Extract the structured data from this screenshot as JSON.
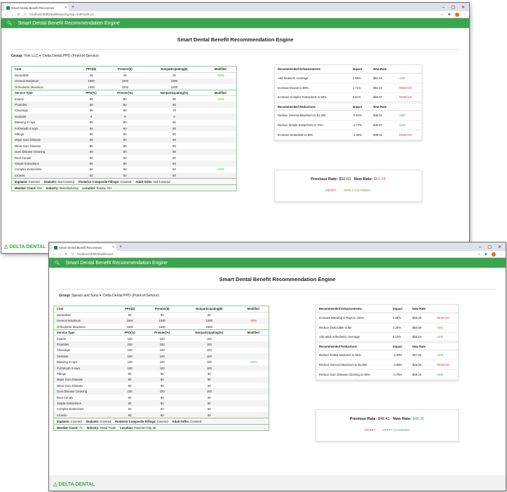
{
  "screenshots": [
    {
      "tab_title": "Smart Dental Benefit Recommen",
      "url": "localhost:3000/dashboard?group=York%20LLC",
      "app_title": "Smart Dental Benefit Recommendation Engine",
      "page_title": "Smart Dental Benefit Recommendation Engine",
      "group_label": "Group:",
      "group_name": "York LLC",
      "plan": "Delta Dental PPO (Point-of-Service)",
      "cost_headers": [
        "Cost",
        "PPO($)",
        "Premier($)",
        "Nonparticipating($)",
        "Modified"
      ],
      "cost_rows": [
        [
          "Deductible",
          "25",
          "25",
          "25",
          "+50%"
        ],
        [
          "General Maximum",
          "1000",
          "1000",
          "1000",
          ""
        ],
        [
          "Orthodontic Maximum",
          "1000",
          "1000",
          "1000",
          ""
        ]
      ],
      "service_headers": [
        "Service Type",
        "PPO(%)",
        "Premier(%)",
        "Nonparticipating(%)",
        "Modified"
      ],
      "service_rows": [
        [
          "Exams",
          "80",
          "80",
          "80",
          "+10%"
        ],
        [
          "Fluorides",
          "80",
          "80",
          "80",
          ""
        ],
        [
          "Cleanings",
          "80",
          "80",
          "70",
          ""
        ],
        [
          "Sealants",
          "0",
          "0",
          "0",
          ""
        ],
        [
          "Bitewing X-rays",
          "80",
          "80",
          "80",
          ""
        ],
        [
          "Full Mouth X-rays",
          "80",
          "80",
          "80",
          ""
        ],
        [
          "Fillings",
          "80",
          "80",
          "80",
          ""
        ],
        [
          "Major Gum Disease",
          "50",
          "50",
          "50",
          ""
        ],
        [
          "Minor Gum Disease",
          "80",
          "80",
          "80",
          ""
        ],
        [
          "Gum Disease Cleaning",
          "80",
          "80",
          "80",
          ""
        ],
        [
          "Root Canals",
          "50",
          "50",
          "50",
          ""
        ],
        [
          "Simple Extractions",
          "80",
          "80",
          "80",
          ""
        ],
        [
          "Complex Extractions",
          "50",
          "50",
          "50",
          "+10%"
        ],
        [
          "Crowns",
          "50",
          "50",
          "50",
          ""
        ]
      ],
      "footer": {
        "implants_label": "Implants:",
        "implants": "Covered",
        "sealants_label": "Sealants:",
        "sealants": "Not Covered",
        "posterior_label": "Posterior Composite Fillings:",
        "posterior": "Covered",
        "adult_orths_label": "Adult Orths:",
        "adult_orths": "Not Covered",
        "member_count_label": "Member Count:",
        "member_count": "231",
        "industry_label": "Industry:",
        "industry": "Manufacturing",
        "location_label": "Location:",
        "location": "Russia, OH"
      },
      "enh_headers": [
        "Recommended Enhancements",
        "Impact",
        "New Rate",
        ""
      ],
      "enhancements": [
        [
          "Add Sealants coverage",
          "1.96%",
          "$51.44",
          "ADD"
        ],
        [
          "Increase Exams to 90%",
          "1.71%",
          "$51.24",
          "REMOVE"
        ],
        [
          "Increase Complex Extractions to 50%",
          "0.61%",
          "$50.67",
          "REMOVE"
        ]
      ],
      "red_headers": [
        "Recommended Reductions",
        "Impact",
        "New Rate",
        ""
      ],
      "reductions": [
        [
          "Reduce General Maximum to $1,250",
          "-0.61%",
          "$48.31",
          "ADD"
        ],
        [
          "Reduce Simple Extractions to 70%",
          "-2.77%",
          "$48.97",
          "ADD"
        ],
        [
          "Increase Deductible to $25",
          "-2.45%",
          "$49.02",
          "REMOVE"
        ]
      ],
      "previous_rate_label": "Previous Rate:",
      "previous_rate": "$50.03",
      "new_rate_label": "New Rate:",
      "new_rate": "$51.24",
      "reset_label": "RESET",
      "apply_label": "APPLY CHANGES",
      "logo_text": "DELTA DENTAL"
    },
    {
      "tab_title": "Smart Dental Benefit Recommen",
      "url": "localhost:3000/dashboard",
      "app_title": "Smart Dental Benefit Recommendation Engine",
      "page_title": "Smart Dental Benefit Recommendation Engine",
      "group_label": "Group:",
      "group_name": "Spears and Sons",
      "plan": "Delta Dental PPO (Point-of-Service)",
      "cost_headers": [
        "Cost",
        "PPO($)",
        "Premier($)",
        "Nonparticipating($)",
        "Modified"
      ],
      "cost_rows": [
        [
          "Deductible",
          "50",
          "50",
          "50",
          ""
        ],
        [
          "General Maximum",
          "1000",
          "1000",
          "1000",
          "-30%"
        ],
        [
          "Orthodontic Maximum",
          "1500",
          "1500",
          "1500",
          ""
        ]
      ],
      "service_headers": [
        "Service Type",
        "PPO(%)",
        "Premier(%)",
        "Nonparticipating(%)",
        "Modified"
      ],
      "service_rows": [
        [
          "Exams",
          "100",
          "100",
          "100",
          ""
        ],
        [
          "Fluorides",
          "100",
          "100",
          "100",
          ""
        ],
        [
          "Cleanings",
          "100",
          "100",
          "100",
          ""
        ],
        [
          "Sealants",
          "100",
          "100",
          "100",
          ""
        ],
        [
          "Bitewing X-rays",
          "100",
          "100",
          "100",
          "+20%"
        ],
        [
          "Full Mouth X-rays",
          "100",
          "100",
          "100",
          ""
        ],
        [
          "Fillings",
          "80",
          "80",
          "80",
          ""
        ],
        [
          "Major Gum Disease",
          "80",
          "80",
          "80",
          ""
        ],
        [
          "Minor Gum Disease",
          "80",
          "80",
          "80",
          ""
        ],
        [
          "Gum Disease Cleaning",
          "100",
          "100",
          "100",
          ""
        ],
        [
          "Root Canals",
          "80",
          "80",
          "80",
          ""
        ],
        [
          "Simple Extractions",
          "80",
          "80",
          "80",
          ""
        ],
        [
          "Complex Extractions",
          "50",
          "50",
          "50",
          ""
        ],
        [
          "Crowns",
          "50",
          "50",
          "50",
          ""
        ]
      ],
      "footer": {
        "implants_label": "Implants:",
        "implants": "Covered",
        "sealants_label": "Sealants:",
        "sealants": "Covered",
        "posterior_label": "Posterior Composite Fillings:",
        "posterior": "Covered",
        "adult_orths_label": "Adult Orths:",
        "adult_orths": "Covered",
        "member_count_label": "Member Count:",
        "member_count": "71",
        "industry_label": "Industry:",
        "industry": "Retail Trade",
        "location_label": "Location:",
        "location": "Traverse City, MI"
      },
      "enh_headers": [
        "Recommended Enhancements",
        "Impact",
        "New Rate",
        ""
      ],
      "enhancements": [
        [
          "Increase Bitewing X-Rays to 100%",
          "1.56%",
          "$49.26",
          "REMOVE"
        ],
        [
          "Reduce Deductible to $0",
          "3.20%",
          "$50.06",
          "ADD"
        ],
        [
          "Add adult orthodontic coverage",
          "4.10%",
          "$50.54",
          "ADD"
        ]
      ],
      "red_headers": [
        "Recommended Reductions",
        "Impact",
        "New Rate",
        ""
      ],
      "reductions": [
        [
          "Reduce Partial Dentures to 50%",
          "-2.39%",
          "$47.25",
          "ADD"
        ],
        [
          "Reduce General Maximum to $1,000",
          "-4.68%",
          "$46.25",
          "REMOVE"
        ],
        [
          "Reduce Gum Disease Cleaning to 80%",
          "-0.75%",
          "$48.15",
          "ADD"
        ]
      ],
      "previous_rate_label": "Previous Rate:",
      "previous_rate": "$48.41",
      "new_rate_label": "New Rate:",
      "new_rate": "$46.25",
      "reset_label": "RESET",
      "apply_label": "APPLY CHANGES",
      "logo_text": "DELTA DENTAL"
    }
  ]
}
